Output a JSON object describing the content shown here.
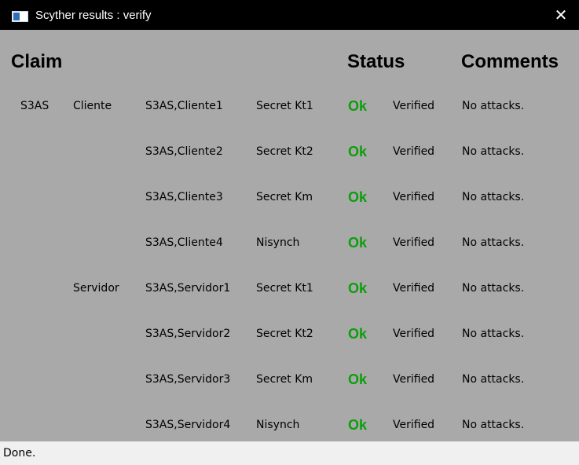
{
  "window": {
    "title": "Scyther results : verify",
    "close_glyph": "✕",
    "icon": "scyther-app-icon"
  },
  "headers": {
    "claim": "Claim",
    "status": "Status",
    "comments": "Comments"
  },
  "rows": [
    {
      "protocol": "S3AS",
      "role": "Cliente",
      "claim_id": "S3AS,Cliente1",
      "claim": "Secret Kt1",
      "status": "Ok",
      "verdict": "Verified",
      "comment": "No attacks."
    },
    {
      "protocol": "",
      "role": "",
      "claim_id": "S3AS,Cliente2",
      "claim": "Secret Kt2",
      "status": "Ok",
      "verdict": "Verified",
      "comment": "No attacks."
    },
    {
      "protocol": "",
      "role": "",
      "claim_id": "S3AS,Cliente3",
      "claim": "Secret Km",
      "status": "Ok",
      "verdict": "Verified",
      "comment": "No attacks."
    },
    {
      "protocol": "",
      "role": "",
      "claim_id": "S3AS,Cliente4",
      "claim": "Nisynch",
      "status": "Ok",
      "verdict": "Verified",
      "comment": "No attacks."
    },
    {
      "protocol": "",
      "role": "Servidor",
      "claim_id": "S3AS,Servidor1",
      "claim": "Secret Kt1",
      "status": "Ok",
      "verdict": "Verified",
      "comment": "No attacks."
    },
    {
      "protocol": "",
      "role": "",
      "claim_id": "S3AS,Servidor2",
      "claim": "Secret Kt2",
      "status": "Ok",
      "verdict": "Verified",
      "comment": "No attacks."
    },
    {
      "protocol": "",
      "role": "",
      "claim_id": "S3AS,Servidor3",
      "claim": "Secret Km",
      "status": "Ok",
      "verdict": "Verified",
      "comment": "No attacks."
    },
    {
      "protocol": "",
      "role": "",
      "claim_id": "S3AS,Servidor4",
      "claim": "Nisynch",
      "status": "Ok",
      "verdict": "Verified",
      "comment": "No attacks."
    }
  ],
  "statusbar": {
    "text": "Done."
  },
  "colors": {
    "titlebar": "#000000",
    "background": "#a9a9a9",
    "ok_green": "#0a9f0a",
    "statusbar": "#f0f0f0"
  }
}
